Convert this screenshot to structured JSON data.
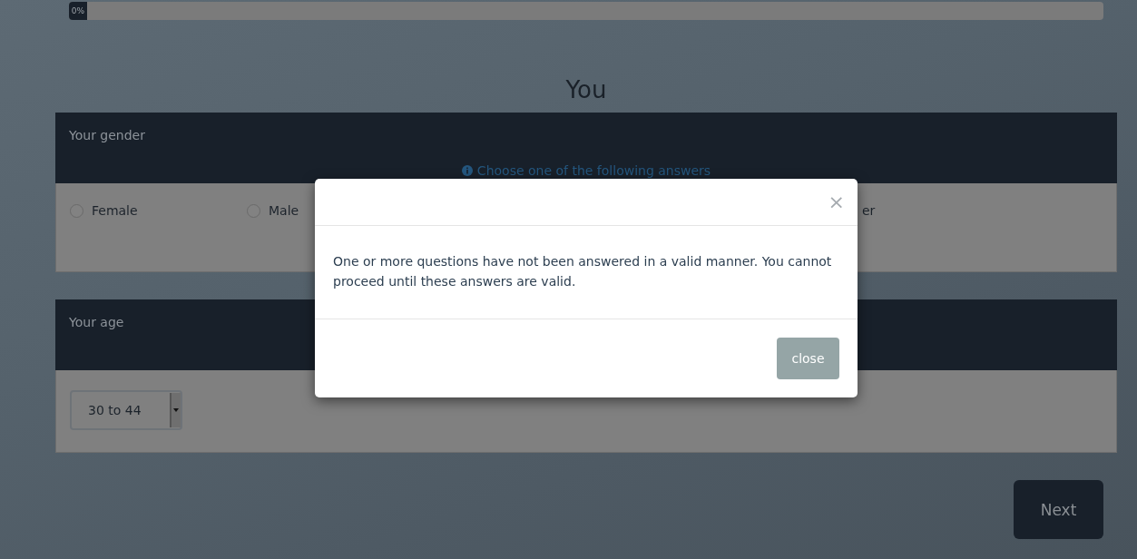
{
  "progress": {
    "label": "0%",
    "level": 0
  },
  "title": "You",
  "questions": [
    {
      "kind": "radio",
      "label": "Your gender",
      "hint": "Choose one of the following answers",
      "options": [
        {
          "kind": "radio",
          "label": "Female",
          "selected": false
        },
        {
          "kind": "radio",
          "label": "Male",
          "selected": false
        },
        {
          "kind": "partial",
          "label": "er"
        }
      ]
    },
    {
      "kind": "select",
      "label": "Your age",
      "value": "30 to 44"
    }
  ],
  "next_button": "Next",
  "modal": {
    "close_icon": "×",
    "message": "One or more questions have not been answered in a valid manner. You cannot proceed until these answers are valid.",
    "close_button": "close"
  }
}
